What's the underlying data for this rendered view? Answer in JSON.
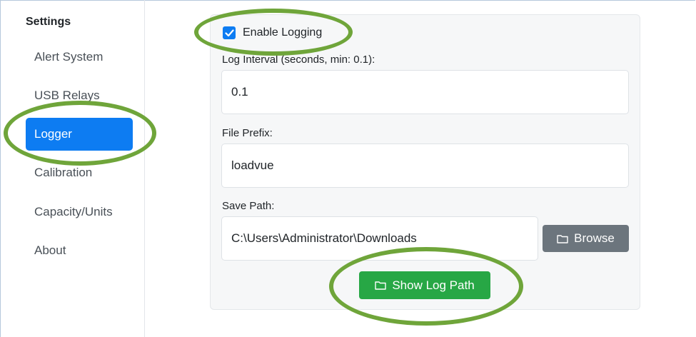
{
  "sidebar": {
    "title": "Settings",
    "items": [
      {
        "label": "Alert System"
      },
      {
        "label": "USB Relays"
      },
      {
        "label": "Logger"
      },
      {
        "label": "Calibration"
      },
      {
        "label": "Capacity/Units"
      },
      {
        "label": "About"
      }
    ],
    "active_item": "Logger"
  },
  "logger": {
    "enable_label": "Enable Logging",
    "enabled": true,
    "interval_label": "Log Interval (seconds, min: 0.1):",
    "interval_value": "0.1",
    "prefix_label": "File Prefix:",
    "prefix_value": "loadvue",
    "path_label": "Save Path:",
    "path_value": "C:\\Users\\Administrator\\Downloads",
    "browse_label": "Browse",
    "show_path_label": "Show Log Path"
  },
  "colors": {
    "accent": "#0d7cf2",
    "success": "#27a745",
    "secondary": "#6c757d",
    "highlight": "#6fa53a"
  },
  "icons": [
    "checkmark-icon",
    "folder-icon"
  ]
}
